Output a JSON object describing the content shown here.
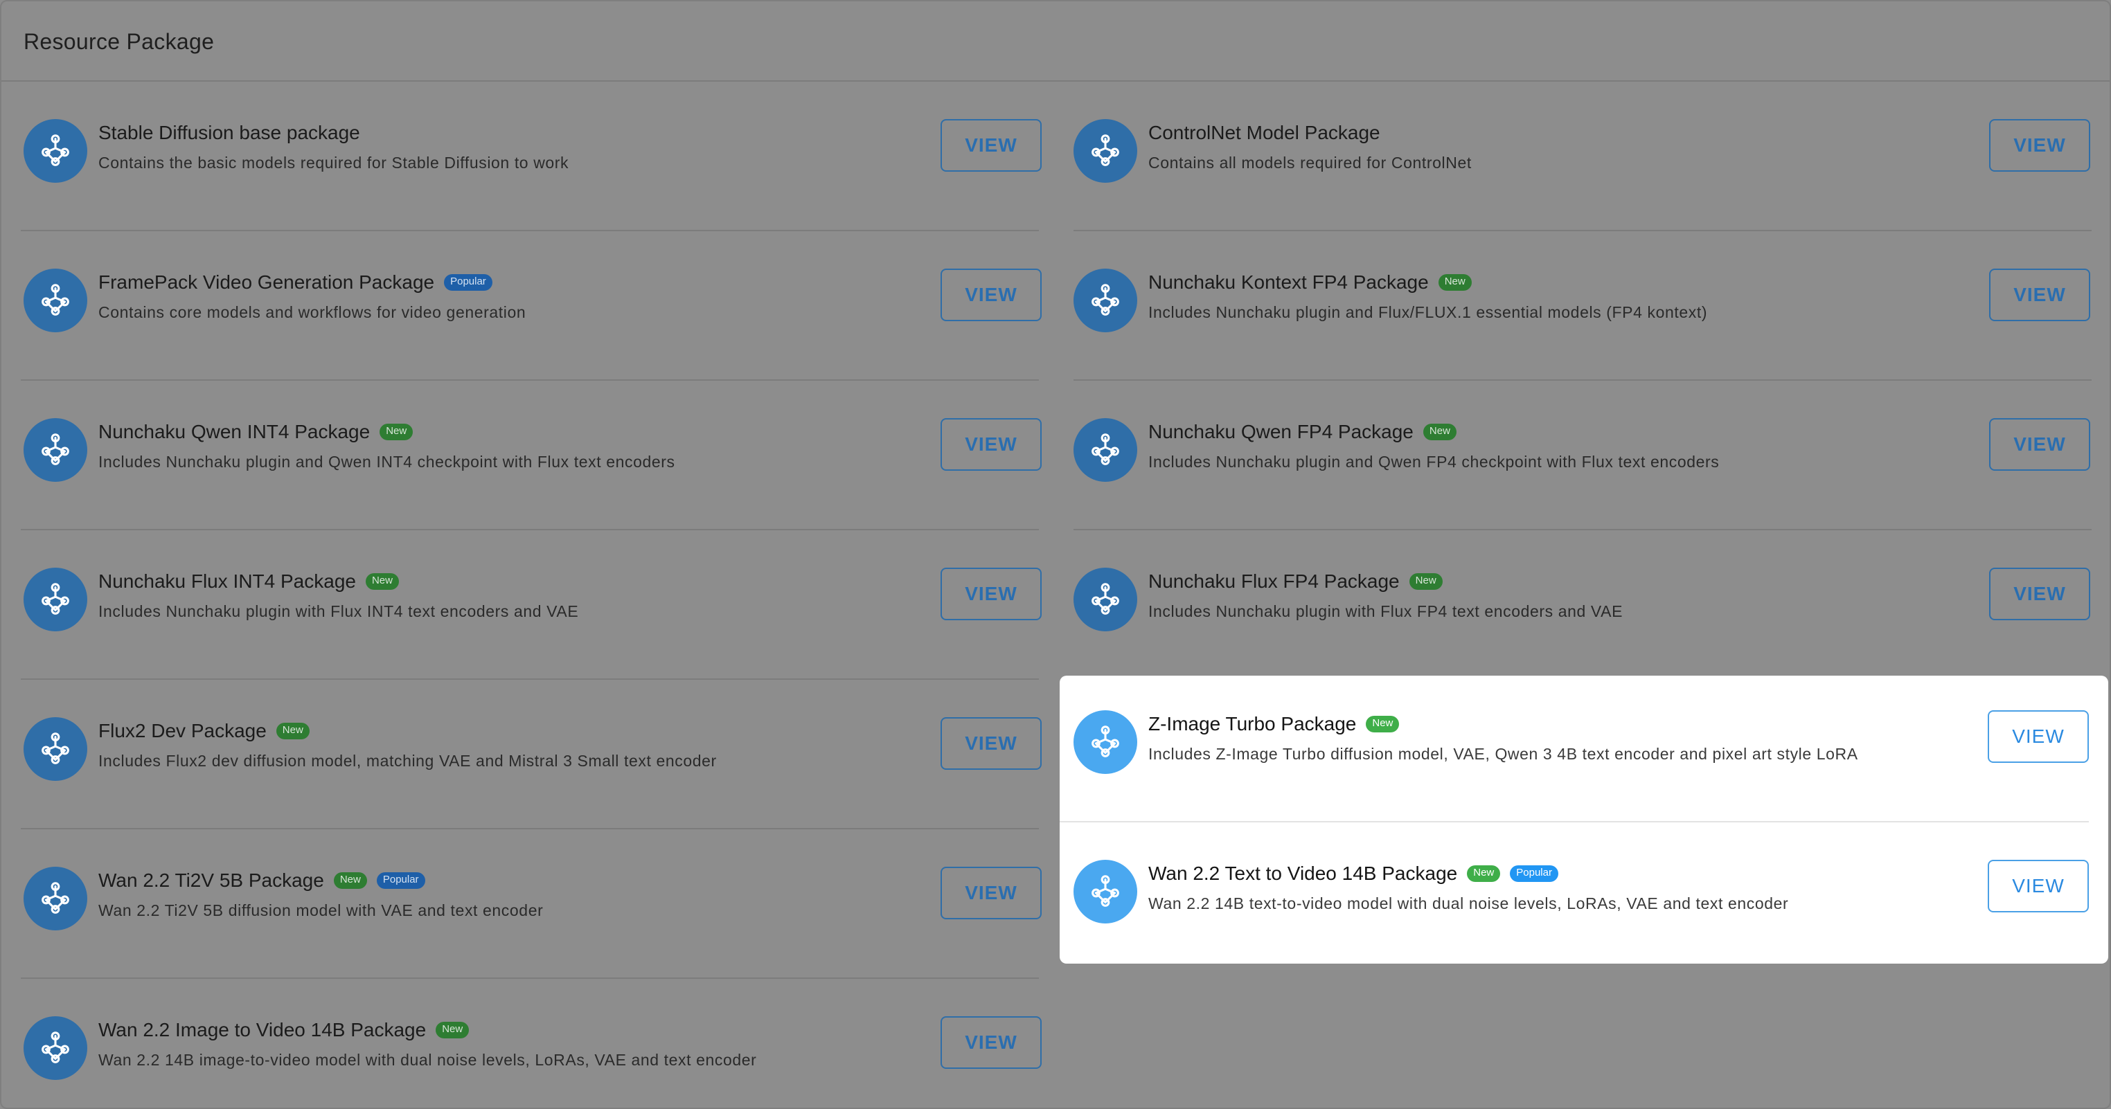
{
  "header": {
    "title": "Resource Package"
  },
  "view_label": "VIEW",
  "colors": {
    "icon_bg_dim": "#2f6ea8",
    "icon_bg_active": "#4aa8f0",
    "badge_new": "#3fae49",
    "badge_popular": "#2196f3"
  },
  "packages": [
    {
      "title": "Stable Diffusion base package",
      "badges": [],
      "description": "Contains the basic models required for Stable Diffusion to work"
    },
    {
      "title": "ControlNet Model Package",
      "badges": [],
      "description": "Contains all models required for ControlNet"
    },
    {
      "title": "FramePack Video Generation Package",
      "badges": [
        "Popular"
      ],
      "description": "Contains core models and workflows for video generation"
    },
    {
      "title": "Nunchaku Kontext FP4 Package",
      "badges": [
        "New"
      ],
      "description": "Includes Nunchaku plugin and Flux/FLUX.1 essential models (FP4 kontext)"
    },
    {
      "title": "Nunchaku Qwen INT4 Package",
      "badges": [
        "New"
      ],
      "description": "Includes Nunchaku plugin and Qwen INT4 checkpoint with Flux text encoders"
    },
    {
      "title": "Nunchaku Qwen FP4 Package",
      "badges": [
        "New"
      ],
      "description": "Includes Nunchaku plugin and Qwen FP4 checkpoint with Flux text encoders"
    },
    {
      "title": "Nunchaku Flux INT4 Package",
      "badges": [
        "New"
      ],
      "description": "Includes Nunchaku plugin with Flux INT4 text encoders and VAE"
    },
    {
      "title": "Nunchaku Flux FP4 Package",
      "badges": [
        "New"
      ],
      "description": "Includes Nunchaku plugin with Flux FP4 text encoders and VAE"
    },
    {
      "title": "Flux2 Dev Package",
      "badges": [
        "New"
      ],
      "description": "Includes Flux2 dev diffusion model, matching VAE and Mistral 3 Small text encoder"
    },
    {
      "title": "Z-Image Turbo Package",
      "badges": [
        "New"
      ],
      "description": "Includes Z-Image Turbo diffusion model, VAE, Qwen 3 4B text encoder and pixel art style LoRA"
    },
    {
      "title": "Wan 2.2 Ti2V 5B Package",
      "badges": [
        "New",
        "Popular"
      ],
      "description": "Wan 2.2 Ti2V 5B diffusion model with VAE and text encoder"
    },
    {
      "title": "Wan 2.2 Text to Video 14B Package",
      "badges": [
        "New",
        "Popular"
      ],
      "description": "Wan 2.2 14B text-to-video model with dual noise levels, LoRAs, VAE and text encoder"
    },
    {
      "title": "Wan 2.2 Image to Video 14B Package",
      "badges": [
        "New"
      ],
      "description": "Wan 2.2 14B image-to-video model with dual noise levels, LoRAs, VAE and text encoder"
    }
  ]
}
